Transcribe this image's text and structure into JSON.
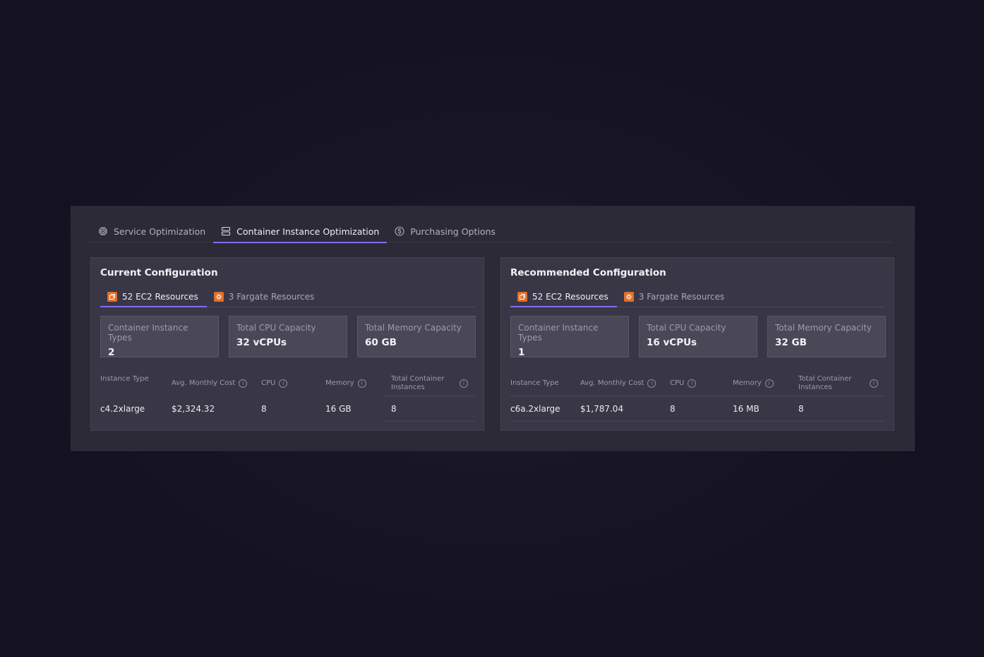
{
  "tabs": [
    {
      "label": "Service Optimization",
      "icon": "chip-icon"
    },
    {
      "label": "Container Instance Optimization",
      "icon": "server-icon",
      "active": true
    },
    {
      "label": "Purchasing Options",
      "icon": "dollar-icon"
    }
  ],
  "colors": {
    "accent": "#7b6ff0",
    "resource_icon": "#e2702a"
  },
  "current": {
    "title": "Current Configuration",
    "subtabs": [
      "52 EC2 Resources",
      "3 Fargate Resources"
    ],
    "stats": [
      {
        "label": "Container Instance Types",
        "value": "2"
      },
      {
        "label": "Total CPU Capacity",
        "value": "32 vCPUs"
      },
      {
        "label": "Total Memory Capacity",
        "value": "60 GB"
      }
    ],
    "table": {
      "headers": [
        "Instance Type",
        "Avg. Monthly Cost",
        "CPU",
        "Memory",
        "Total Container Instances"
      ],
      "row": [
        "c4.2xlarge",
        "$2,324.32",
        "8",
        "16 GB",
        "8"
      ]
    }
  },
  "recommended": {
    "title": "Recommended Configuration",
    "subtabs": [
      "52 EC2 Resources",
      "3 Fargate Resources"
    ],
    "stats": [
      {
        "label": "Container Instance Types",
        "value": "1"
      },
      {
        "label": "Total CPU Capacity",
        "value": "16 vCPUs"
      },
      {
        "label": "Total Memory Capacity",
        "value": "32 GB"
      }
    ],
    "table": {
      "headers": [
        "Instance Type",
        "Avg. Monthly Cost",
        "CPU",
        "Memory",
        "Total Container Instances"
      ],
      "row": [
        "c6a.2xlarge",
        "$1,787.04",
        "8",
        "16 MB",
        "8"
      ]
    }
  }
}
